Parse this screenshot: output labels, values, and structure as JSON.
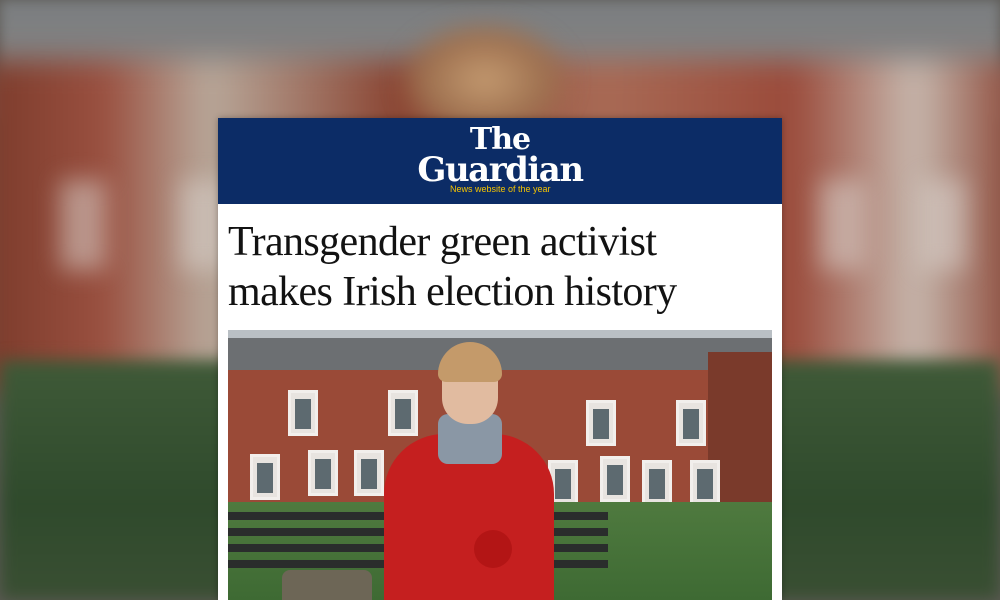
{
  "masthead": {
    "logo_line1": "The",
    "logo_line2": "Guardian",
    "tagline": "News website of the year"
  },
  "article": {
    "headline_line1": "Transgender green activist",
    "headline_line2": "makes Irish election history"
  },
  "colors": {
    "masthead_bg": "#0c2c66",
    "tagline": "#f5c400",
    "coat": "#c51f1f"
  }
}
